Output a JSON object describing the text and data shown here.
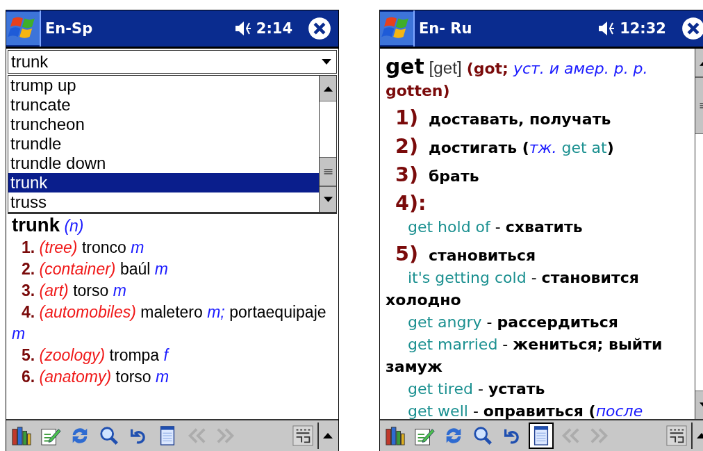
{
  "devices": [
    {
      "title": "En-Sp",
      "time": "2:14",
      "search": {
        "value": "trunk"
      },
      "word_list": [
        {
          "text": "trump up",
          "selected": false
        },
        {
          "text": "truncate",
          "selected": false
        },
        {
          "text": "truncheon",
          "selected": false
        },
        {
          "text": "trundle",
          "selected": false
        },
        {
          "text": "trundle down",
          "selected": false
        },
        {
          "text": "trunk",
          "selected": true
        },
        {
          "text": "truss",
          "selected": false
        }
      ],
      "entry": [
        {
          "kind": "head",
          "segments": [
            {
              "kind": "headword",
              "text": "trunk"
            },
            {
              "kind": "pos",
              "text": "(n)"
            }
          ]
        },
        {
          "kind": "sense",
          "segments": [
            {
              "kind": "num",
              "text": "1."
            },
            {
              "kind": "label",
              "text": "(tree)"
            },
            {
              "kind": "text",
              "text": "tronco"
            },
            {
              "kind": "gram",
              "text": "m"
            }
          ]
        },
        {
          "kind": "sense",
          "segments": [
            {
              "kind": "num",
              "text": "2."
            },
            {
              "kind": "label",
              "text": "(container)"
            },
            {
              "kind": "text",
              "text": "baúl"
            },
            {
              "kind": "gram",
              "text": "m"
            }
          ]
        },
        {
          "kind": "sense",
          "segments": [
            {
              "kind": "num",
              "text": "3."
            },
            {
              "kind": "label",
              "text": "(art)"
            },
            {
              "kind": "text",
              "text": "torso"
            },
            {
              "kind": "gram",
              "text": "m"
            }
          ]
        },
        {
          "kind": "sense",
          "segments": [
            {
              "kind": "num",
              "text": "4."
            },
            {
              "kind": "label",
              "text": "(automobiles)"
            },
            {
              "kind": "text",
              "text": "maletero"
            },
            {
              "kind": "gram",
              "text": "m;"
            },
            {
              "kind": "text",
              "text": "portaequipaje"
            },
            {
              "kind": "gram",
              "text": "m"
            }
          ]
        },
        {
          "kind": "sense",
          "segments": [
            {
              "kind": "num",
              "text": "5."
            },
            {
              "kind": "label",
              "text": "(zoology)"
            },
            {
              "kind": "text",
              "text": "trompa"
            },
            {
              "kind": "gram",
              "text": "f"
            }
          ]
        },
        {
          "kind": "sense",
          "segments": [
            {
              "kind": "num",
              "text": "6."
            },
            {
              "kind": "label",
              "text": "(anatomy)"
            },
            {
              "kind": "text",
              "text": "torso"
            },
            {
              "kind": "gram",
              "text": "m"
            }
          ]
        }
      ],
      "toolbar": [
        {
          "kind": "books",
          "selected": false,
          "disabled": false
        },
        {
          "kind": "note",
          "selected": false,
          "disabled": false
        },
        {
          "kind": "sync",
          "selected": false,
          "disabled": false
        },
        {
          "kind": "search",
          "selected": false,
          "disabled": false
        },
        {
          "kind": "undo",
          "selected": false,
          "disabled": false
        },
        {
          "kind": "page",
          "selected": false,
          "disabled": false
        },
        {
          "kind": "back",
          "selected": false,
          "disabled": true
        },
        {
          "kind": "forward",
          "selected": false,
          "disabled": true
        }
      ]
    },
    {
      "title": "En- Ru",
      "time": "12:32",
      "entry": [
        {
          "kind": "head",
          "segments": [
            {
              "kind": "headword",
              "text": "get"
            },
            {
              "kind": "transcription",
              "text": "[get]"
            },
            {
              "kind": "form",
              "text": "(got;"
            },
            {
              "kind": "gram",
              "text": "уст. и амер. p. p."
            },
            {
              "kind": "form",
              "text": "gotten)"
            }
          ]
        },
        {
          "kind": "sense",
          "segments": [
            {
              "kind": "num",
              "text": "1)"
            },
            {
              "kind": "ru",
              "text": "доставать, получать"
            }
          ]
        },
        {
          "kind": "sense",
          "segments": [
            {
              "kind": "num",
              "text": "2)"
            },
            {
              "kind": "ru",
              "text": "достигать ("
            },
            {
              "kind": "gram",
              "text": "тж.",
              "tight": true
            },
            {
              "kind": "phrase",
              "text": "get at"
            },
            {
              "kind": "ru",
              "text": ")",
              "tight": true
            }
          ]
        },
        {
          "kind": "sense",
          "segments": [
            {
              "kind": "num",
              "text": "3)"
            },
            {
              "kind": "ru",
              "text": "брать"
            }
          ]
        },
        {
          "kind": "sense",
          "segments": [
            {
              "kind": "num",
              "text": "4):"
            }
          ]
        },
        {
          "kind": "example",
          "segments": [
            {
              "kind": "phrase",
              "text": "get hold of"
            },
            {
              "kind": "dash",
              "text": "-"
            },
            {
              "kind": "ru",
              "text": "схватить"
            }
          ]
        },
        {
          "kind": "sense",
          "segments": [
            {
              "kind": "num",
              "text": "5)"
            },
            {
              "kind": "ru",
              "text": "становиться"
            }
          ]
        },
        {
          "kind": "example",
          "segments": [
            {
              "kind": "phrase",
              "text": "it's getting cold"
            },
            {
              "kind": "dash",
              "text": "-"
            },
            {
              "kind": "ru",
              "text": "становится"
            },
            {
              "kind": "ru",
              "text": "холодно"
            }
          ]
        },
        {
          "kind": "example",
          "segments": [
            {
              "kind": "phrase",
              "text": "get angry"
            },
            {
              "kind": "dash",
              "text": "-"
            },
            {
              "kind": "ru",
              "text": "рассердиться"
            }
          ]
        },
        {
          "kind": "example",
          "segments": [
            {
              "kind": "phrase",
              "text": "get married"
            },
            {
              "kind": "dash",
              "text": "-"
            },
            {
              "kind": "ru",
              "text": "жениться; выйти"
            },
            {
              "kind": "ru",
              "text": "замуж"
            }
          ]
        },
        {
          "kind": "example",
          "segments": [
            {
              "kind": "phrase",
              "text": "get tired"
            },
            {
              "kind": "dash",
              "text": "-"
            },
            {
              "kind": "ru",
              "text": "устать"
            }
          ]
        },
        {
          "kind": "example",
          "segments": [
            {
              "kind": "phrase",
              "text": "get well"
            },
            {
              "kind": "dash",
              "text": "-"
            },
            {
              "kind": "ru",
              "text": "оправиться ("
            },
            {
              "kind": "gram",
              "text": "после",
              "tight": true
            }
          ]
        }
      ],
      "toolbar": [
        {
          "kind": "books",
          "selected": false,
          "disabled": false
        },
        {
          "kind": "note",
          "selected": false,
          "disabled": false
        },
        {
          "kind": "sync",
          "selected": false,
          "disabled": false
        },
        {
          "kind": "search",
          "selected": false,
          "disabled": false
        },
        {
          "kind": "undo",
          "selected": false,
          "disabled": false
        },
        {
          "kind": "page",
          "selected": true,
          "disabled": false
        },
        {
          "kind": "back",
          "selected": false,
          "disabled": true
        },
        {
          "kind": "forward",
          "selected": false,
          "disabled": true
        }
      ]
    }
  ]
}
